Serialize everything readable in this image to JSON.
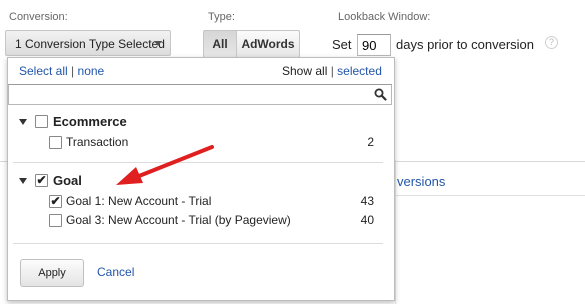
{
  "labels": {
    "conversion": "Conversion:",
    "type": "Type:",
    "lookback": "Lookback Window:"
  },
  "conversion_button": {
    "label": "1 Conversion Type Selected"
  },
  "type_toggle": {
    "all": "All",
    "adwords": "AdWords"
  },
  "lookback": {
    "prefix": "Set",
    "value": "90",
    "suffix": "days prior to conversion",
    "help": "?"
  },
  "background": {
    "link_partial": "versions"
  },
  "dropdown": {
    "select_all": "Select all",
    "sep1": "|",
    "none": "none",
    "show_all": "Show all",
    "sep2": "|",
    "selected": "selected",
    "search_placeholder": "",
    "groups": [
      {
        "name": "Ecommerce",
        "checked": false,
        "items": [
          {
            "label": "Transaction",
            "count": "2",
            "checked": false
          }
        ]
      },
      {
        "name": "Goal",
        "checked": true,
        "items": [
          {
            "label": "Goal 1: New Account - Trial",
            "count": "43",
            "checked": true
          },
          {
            "label": "Goal 3: New Account - Trial (by Pageview)",
            "count": "40",
            "checked": false
          }
        ]
      }
    ],
    "apply": "Apply",
    "cancel": "Cancel"
  },
  "colors": {
    "link": "#2255aa",
    "arrow": "#e02020"
  }
}
